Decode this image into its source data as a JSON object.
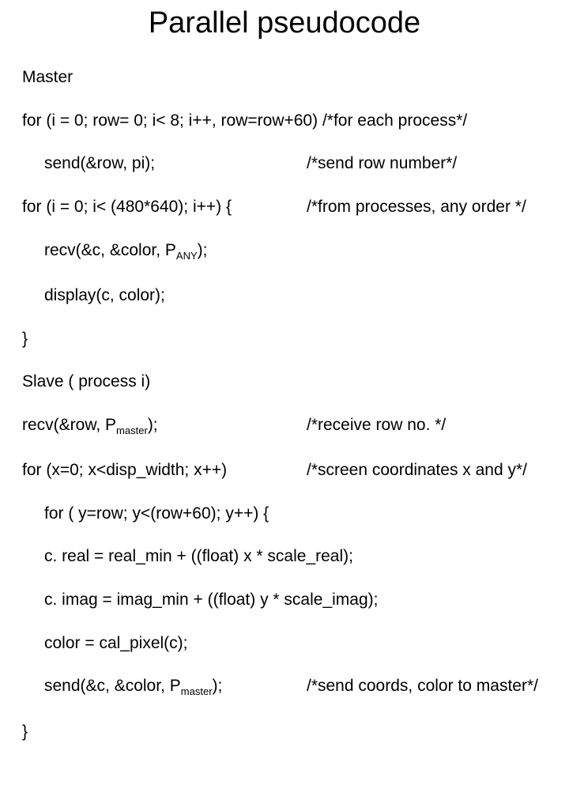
{
  "title": "Parallel pseudocode",
  "h_master": "Master",
  "m1a": "for (i = 0; row= 0; i< 8; i++, row=row+60) ",
  "m1b": "/*for each process*/",
  "m2a": "send(&row, pi);",
  "m2b": "/*send row number*/",
  "m3a": "for (i = 0; i< (480*640); i++) {",
  "m3b": "/*from processes, any order */",
  "m4": "recv(&c, &color, P",
  "m4sub": "ANY",
  "m4end": ");",
  "m5": "display(c, color);",
  "m6": "}",
  "h_slave": "Slave ( process i)",
  "s1a": "recv(&row, P",
  "s1sub": "master",
  "s1end": ");",
  "s1b": "/*receive row no. */",
  "s2a": "for (x=0; x<disp_width; x++)",
  "s2b": "/*screen coordinates x and y*/",
  "s3": "for ( y=row; y<(row+60); y++) {",
  "s4": "c. real = real_min + ((float) x * scale_real);",
  "s5": "c. imag = imag_min + ((float) y * scale_imag);",
  "s6": "color = cal_pixel(c);",
  "s7a": "send(&c, &color, P",
  "s7sub": "master",
  "s7end": ");",
  "s7b": "/*send coords, color to master*/",
  "s8": "}"
}
